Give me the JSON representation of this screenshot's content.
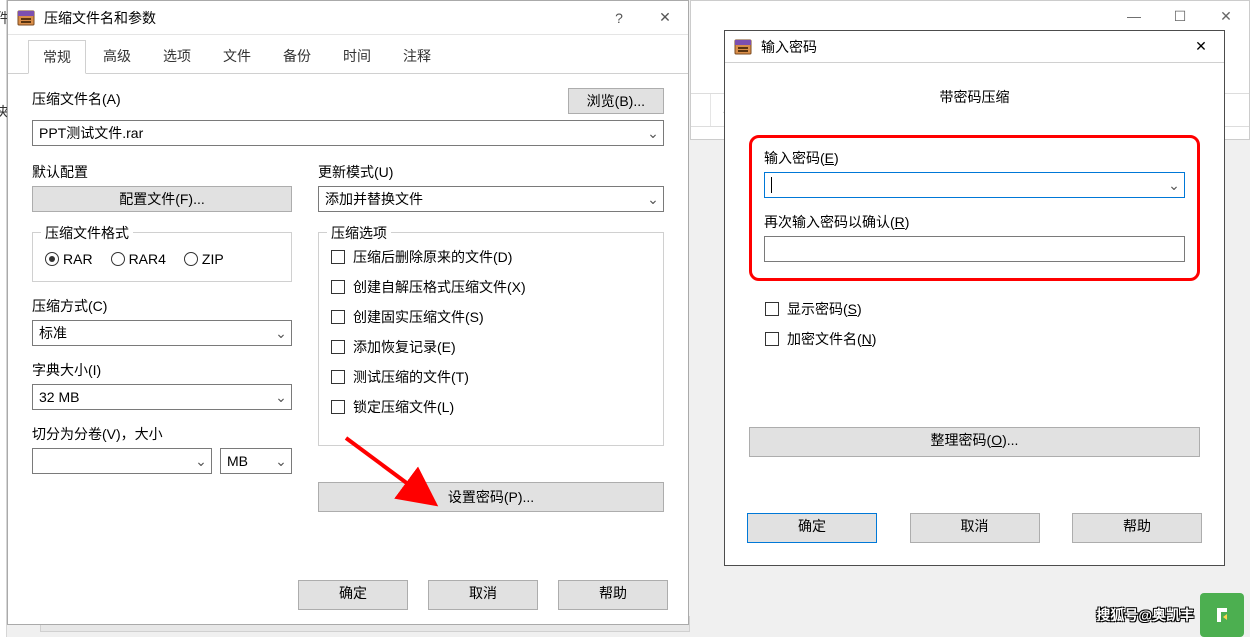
{
  "main_dialog": {
    "title": "压缩文件名和参数",
    "tabs": [
      "常规",
      "高级",
      "选项",
      "文件",
      "备份",
      "时间",
      "注释"
    ],
    "active_tab": 0,
    "archive_name_label": "压缩文件名(A)",
    "browse_btn": "浏览(B)...",
    "archive_name_value": "PPT测试文件.rar",
    "default_profile_label": "默认配置",
    "profile_btn": "配置文件(F)...",
    "update_mode_label": "更新模式(U)",
    "update_mode_value": "添加并替换文件",
    "format_group": "压缩文件格式",
    "formats": [
      "RAR",
      "RAR4",
      "ZIP"
    ],
    "format_selected": 0,
    "options_group": "压缩选项",
    "options": [
      "压缩后删除原来的文件(D)",
      "创建自解压格式压缩文件(X)",
      "创建固实压缩文件(S)",
      "添加恢复记录(E)",
      "测试压缩的文件(T)",
      "锁定压缩文件(L)"
    ],
    "method_label": "压缩方式(C)",
    "method_value": "标准",
    "dict_label": "字典大小(I)",
    "dict_value": "32 MB",
    "split_label": "切分为分卷(V)，大小",
    "split_value": "",
    "split_unit": "MB",
    "password_btn": "设置密码(P)...",
    "ok_btn": "确定",
    "cancel_btn": "取消",
    "help_btn": "帮助"
  },
  "pwd_dialog": {
    "title": "输入密码",
    "heading": "带密码压缩",
    "enter_label_prefix": "输入密码(",
    "enter_label_hot": "E",
    "enter_label_suffix": ")",
    "reenter_label_prefix": "再次输入密码以确认(",
    "reenter_label_hot": "R",
    "reenter_label_suffix": ")",
    "show_pwd_prefix": "显示密码(",
    "show_pwd_hot": "S",
    "show_pwd_suffix": ")",
    "encrypt_names_prefix": "加密文件名(",
    "encrypt_names_hot": "N",
    "encrypt_names_suffix": ")",
    "organize_prefix": "整理密码(",
    "organize_hot": "O",
    "organize_suffix": ")...",
    "ok_btn": "确定",
    "cancel_btn": "取消",
    "help_btn": "帮助"
  },
  "watermark": "搜狐号@奥凯丰",
  "left_fragments": {
    "t1": "件",
    "t2": "夹"
  }
}
